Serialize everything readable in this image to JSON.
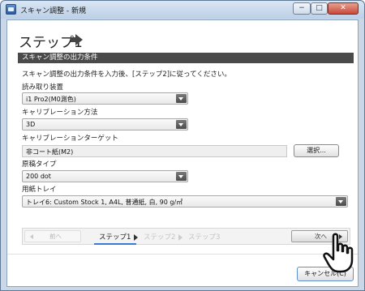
{
  "window": {
    "title": "スキャン調整 - 新規",
    "minimize": "−",
    "maximize": "□",
    "close": "✕"
  },
  "header": {
    "step_title": "ステップ1"
  },
  "section": {
    "title": "スキャン調整の出力条件"
  },
  "instruction": "スキャン調整の出力条件を入力後、[ステップ2]に従ってください。",
  "fields": {
    "reader": {
      "label": "読み取り装置",
      "value": "i1 Pro2(M0測色)"
    },
    "method": {
      "label": "キャリブレーション方法",
      "value": "3D"
    },
    "target": {
      "label": "キャリブレーションターゲット",
      "value": "非コート紙(M2)",
      "button": "選択..."
    },
    "doc_type": {
      "label": "原稿タイプ",
      "value": "200 dot"
    },
    "tray": {
      "label": "用紙トレイ",
      "value": "トレイ6: Custom Stock 1, A4L, 普通紙, 白, 90 g/㎡"
    }
  },
  "wizard": {
    "prev": "前へ",
    "next": "次へ",
    "steps": [
      "ステップ1",
      "ステップ2",
      "ステップ3"
    ]
  },
  "footer": {
    "cancel": "キャンセル(C)"
  }
}
